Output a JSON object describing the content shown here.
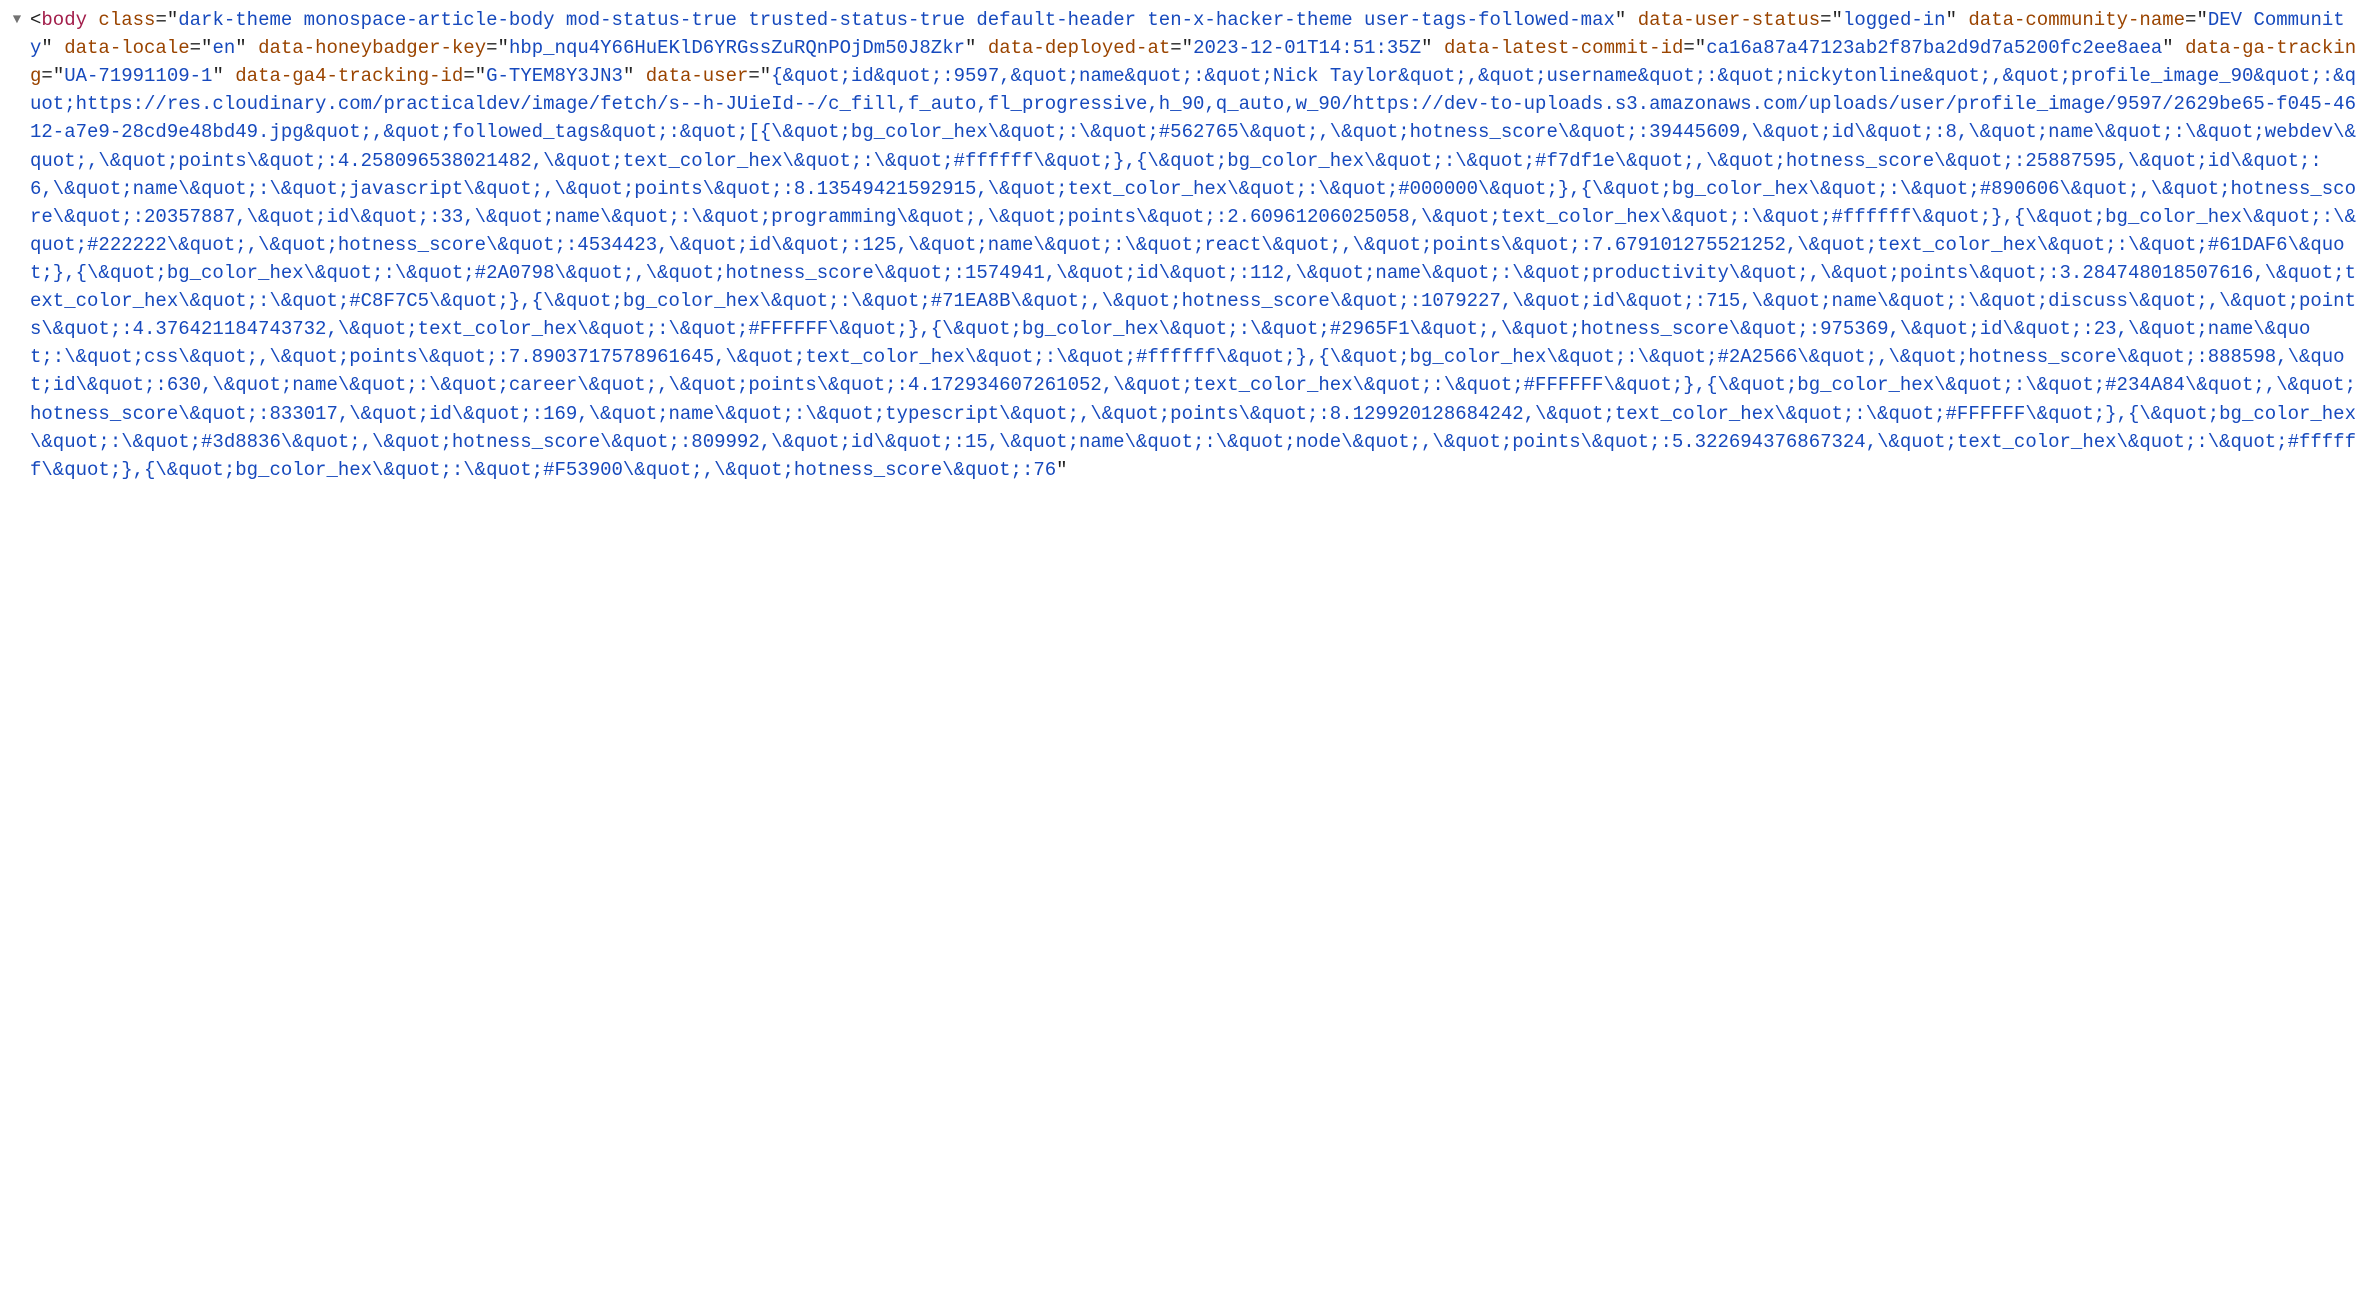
{
  "arrow": "▼",
  "tag_open": "<",
  "tag_name": "body",
  "eq": "=",
  "q": "\"",
  "sp": " ",
  "attrs": [
    {
      "name": "class",
      "value": "dark-theme monospace-article-body mod-status-true trusted-status-true default-header ten-x-hacker-theme user-tags-followed-max"
    },
    {
      "name": "data-user-status",
      "value": "logged-in"
    },
    {
      "name": "data-community-name",
      "value": "DEV Community"
    },
    {
      "name": "data-locale",
      "value": "en"
    },
    {
      "name": "data-honeybadger-key",
      "value": "hbp_nqu4Y66HuEKlD6YRGssZuRQnPOjDm50J8Zkr"
    },
    {
      "name": "data-deployed-at",
      "value": "2023-12-01T14:51:35Z"
    },
    {
      "name": "data-latest-commit-id",
      "value": "ca16a87a47123ab2f87ba2d9d7a5200fc2ee8aea"
    },
    {
      "name": "data-ga-tracking",
      "value": "UA-71991109-1"
    },
    {
      "name": "data-ga4-tracking-id",
      "value": "G-TYEM8Y3JN3"
    },
    {
      "name": "data-user",
      "value": "{&quot;id&quot;:9597,&quot;name&quot;:&quot;Nick Taylor&quot;,&quot;username&quot;:&quot;nickytonline&quot;,&quot;profile_image_90&quot;:&quot;https://res.cloudinary.com/practicaldev/image/fetch/s--h-JUieId--/c_fill,f_auto,fl_progressive,h_90,q_auto,w_90/https://dev-to-uploads.s3.amazonaws.com/uploads/user/profile_image/9597/2629be65-f045-4612-a7e9-28cd9e48bd49.jpg&quot;,&quot;followed_tags&quot;:&quot;[{\\&quot;bg_color_hex\\&quot;:\\&quot;#562765\\&quot;,\\&quot;hotness_score\\&quot;:39445609,\\&quot;id\\&quot;:8,\\&quot;name\\&quot;:\\&quot;webdev\\&quot;,\\&quot;points\\&quot;:4.258096538021482,\\&quot;text_color_hex\\&quot;:\\&quot;#ffffff\\&quot;},{\\&quot;bg_color_hex\\&quot;:\\&quot;#f7df1e\\&quot;,\\&quot;hotness_score\\&quot;:25887595,\\&quot;id\\&quot;:6,\\&quot;name\\&quot;:\\&quot;javascript\\&quot;,\\&quot;points\\&quot;:8.13549421592915,\\&quot;text_color_hex\\&quot;:\\&quot;#000000\\&quot;},{\\&quot;bg_color_hex\\&quot;:\\&quot;#890606\\&quot;,\\&quot;hotness_score\\&quot;:20357887,\\&quot;id\\&quot;:33,\\&quot;name\\&quot;:\\&quot;programming\\&quot;,\\&quot;points\\&quot;:2.60961206025058,\\&quot;text_color_hex\\&quot;:\\&quot;#ffffff\\&quot;},{\\&quot;bg_color_hex\\&quot;:\\&quot;#222222\\&quot;,\\&quot;hotness_score\\&quot;:4534423,\\&quot;id\\&quot;:125,\\&quot;name\\&quot;:\\&quot;react\\&quot;,\\&quot;points\\&quot;:7.679101275521252,\\&quot;text_color_hex\\&quot;:\\&quot;#61DAF6\\&quot;},{\\&quot;bg_color_hex\\&quot;:\\&quot;#2A0798\\&quot;,\\&quot;hotness_score\\&quot;:1574941,\\&quot;id\\&quot;:112,\\&quot;name\\&quot;:\\&quot;productivity\\&quot;,\\&quot;points\\&quot;:3.284748018507616,\\&quot;text_color_hex\\&quot;:\\&quot;#C8F7C5\\&quot;},{\\&quot;bg_color_hex\\&quot;:\\&quot;#71EA8B\\&quot;,\\&quot;hotness_score\\&quot;:1079227,\\&quot;id\\&quot;:715,\\&quot;name\\&quot;:\\&quot;discuss\\&quot;,\\&quot;points\\&quot;:4.376421184743732,\\&quot;text_color_hex\\&quot;:\\&quot;#FFFFFF\\&quot;},{\\&quot;bg_color_hex\\&quot;:\\&quot;#2965F1\\&quot;,\\&quot;hotness_score\\&quot;:975369,\\&quot;id\\&quot;:23,\\&quot;name\\&quot;:\\&quot;css\\&quot;,\\&quot;points\\&quot;:7.8903717578961645,\\&quot;text_color_hex\\&quot;:\\&quot;#ffffff\\&quot;},{\\&quot;bg_color_hex\\&quot;:\\&quot;#2A2566\\&quot;,\\&quot;hotness_score\\&quot;:888598,\\&quot;id\\&quot;:630,\\&quot;name\\&quot;:\\&quot;career\\&quot;,\\&quot;points\\&quot;:4.172934607261052,\\&quot;text_color_hex\\&quot;:\\&quot;#FFFFFF\\&quot;},{\\&quot;bg_color_hex\\&quot;:\\&quot;#234A84\\&quot;,\\&quot;hotness_score\\&quot;:833017,\\&quot;id\\&quot;:169,\\&quot;name\\&quot;:\\&quot;typescript\\&quot;,\\&quot;points\\&quot;:8.129920128684242,\\&quot;text_color_hex\\&quot;:\\&quot;#FFFFFF\\&quot;},{\\&quot;bg_color_hex\\&quot;:\\&quot;#3d8836\\&quot;,\\&quot;hotness_score\\&quot;:809992,\\&quot;id\\&quot;:15,\\&quot;name\\&quot;:\\&quot;node\\&quot;,\\&quot;points\\&quot;:5.322694376867324,\\&quot;text_color_hex\\&quot;:\\&quot;#ffffff\\&quot;},{\\&quot;bg_color_hex\\&quot;:\\&quot;#F53900\\&quot;,\\&quot;hotness_score\\&quot;:76"
    }
  ]
}
